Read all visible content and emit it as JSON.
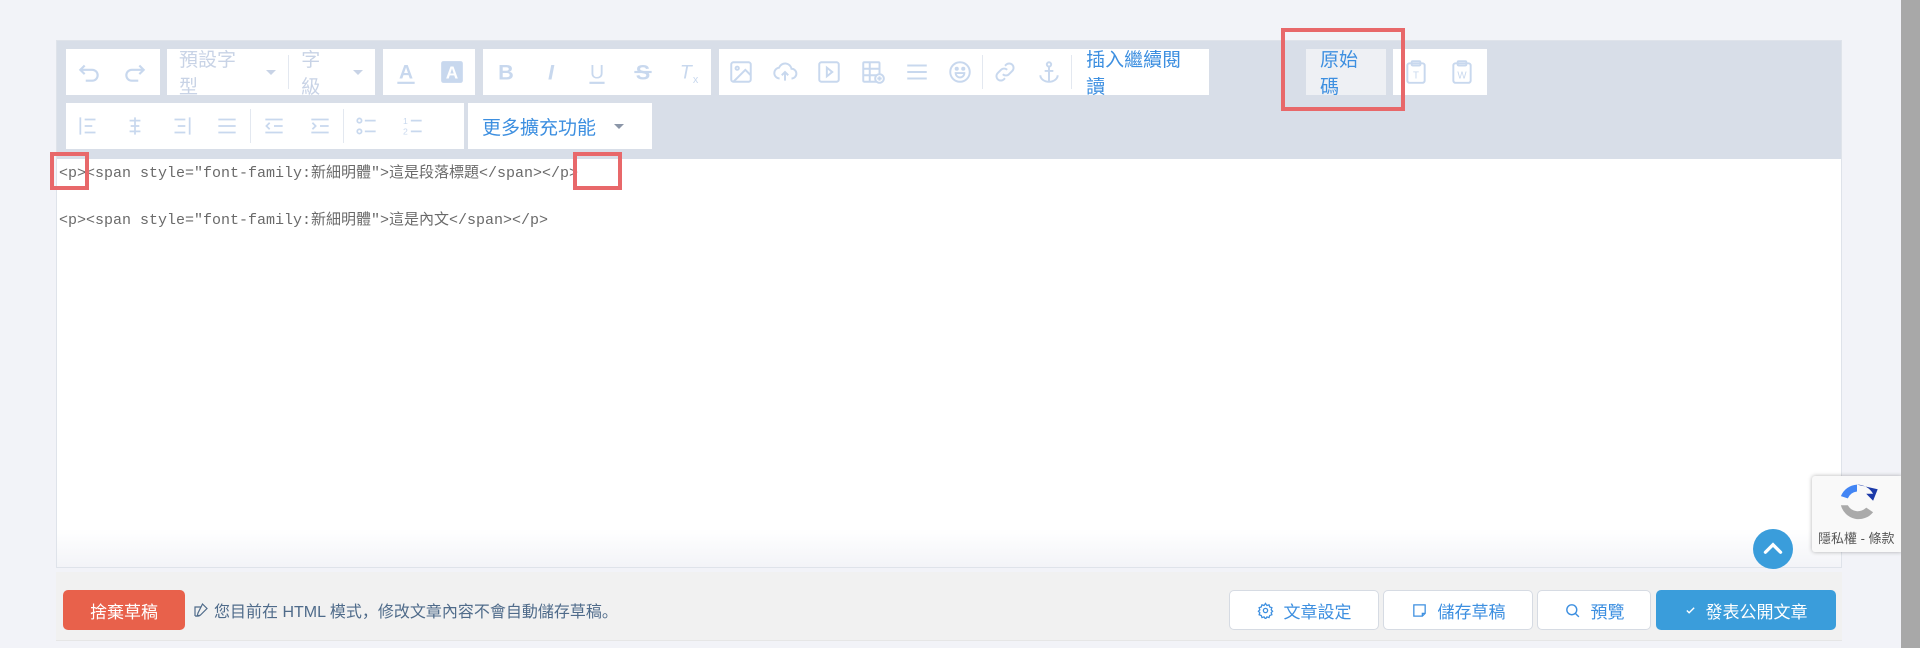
{
  "toolbar": {
    "font_family_select": "預設字型",
    "font_size_select": "字級",
    "insert_read_more": "插入繼續閱讀",
    "source_code": "原始碼",
    "more_features": "更多擴充功能"
  },
  "content": {
    "lines": [
      "<p><span style=\"font-family:新細明體\">這是段落標題</span></p>",
      "<p><span style=\"font-family:新細明體\">這是內文</span></p>"
    ]
  },
  "footer": {
    "discard_draft": "捨棄草稿",
    "notice": "您目前在 HTML 模式，修改文章內容不會自動儲存草稿。",
    "article_settings": "文章設定",
    "save_draft": "儲存草稿",
    "preview": "預覽",
    "publish": "發表公開文章"
  },
  "recaptcha": {
    "label": "隱私權 - 條款"
  },
  "colors": {
    "accent": "#3d8fe0",
    "danger": "#e8614b",
    "primary": "#3a9ddb",
    "highlight": "#e8686a"
  }
}
